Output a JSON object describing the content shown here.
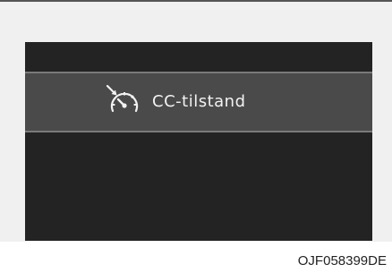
{
  "display": {
    "selected_item": {
      "label": "CC-tilstand",
      "icon": "cruise-control-gauge-icon"
    }
  },
  "caption": "OJF058399DE",
  "colors": {
    "screen_background": "#232323",
    "selected_row_background": "#4a4a4a",
    "text": "#f2f2f2",
    "frame_background": "#f0f0f0"
  }
}
